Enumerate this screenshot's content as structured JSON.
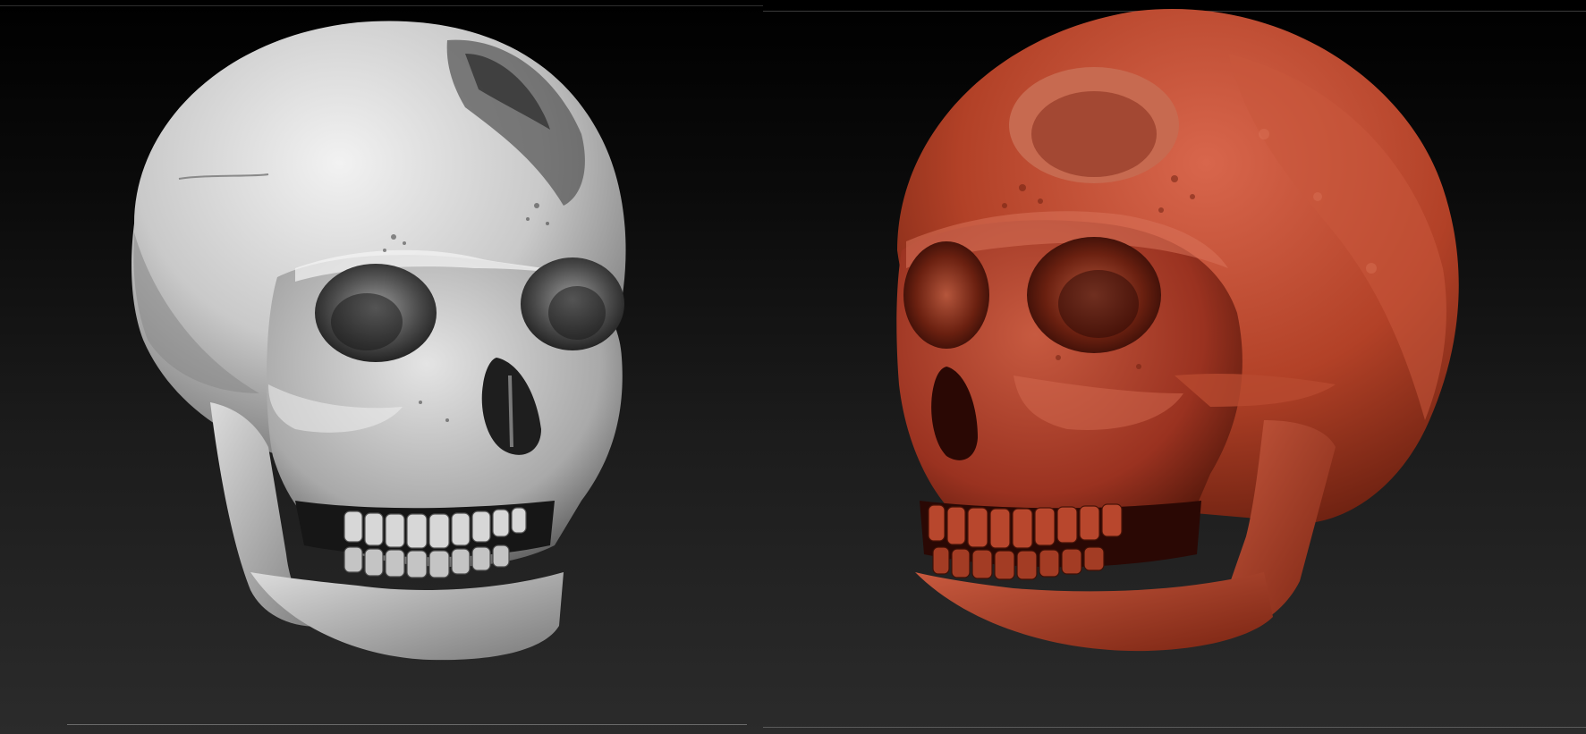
{
  "viewports": [
    {
      "name": "grey-sculpt-view",
      "material": "grey-clay",
      "base_color": "#d9d9d9"
    },
    {
      "name": "red-sculpt-view",
      "material": "red-wax",
      "base_color": "#b33a26"
    }
  ],
  "colors": {
    "background_top": "#000000",
    "background_bottom": "#2b2b2b",
    "grey_skull_light": "#e6e6e6",
    "grey_skull_shadow": "#3c3c3c",
    "red_skull_light": "#d9644a",
    "red_skull_shadow": "#4a1408"
  }
}
